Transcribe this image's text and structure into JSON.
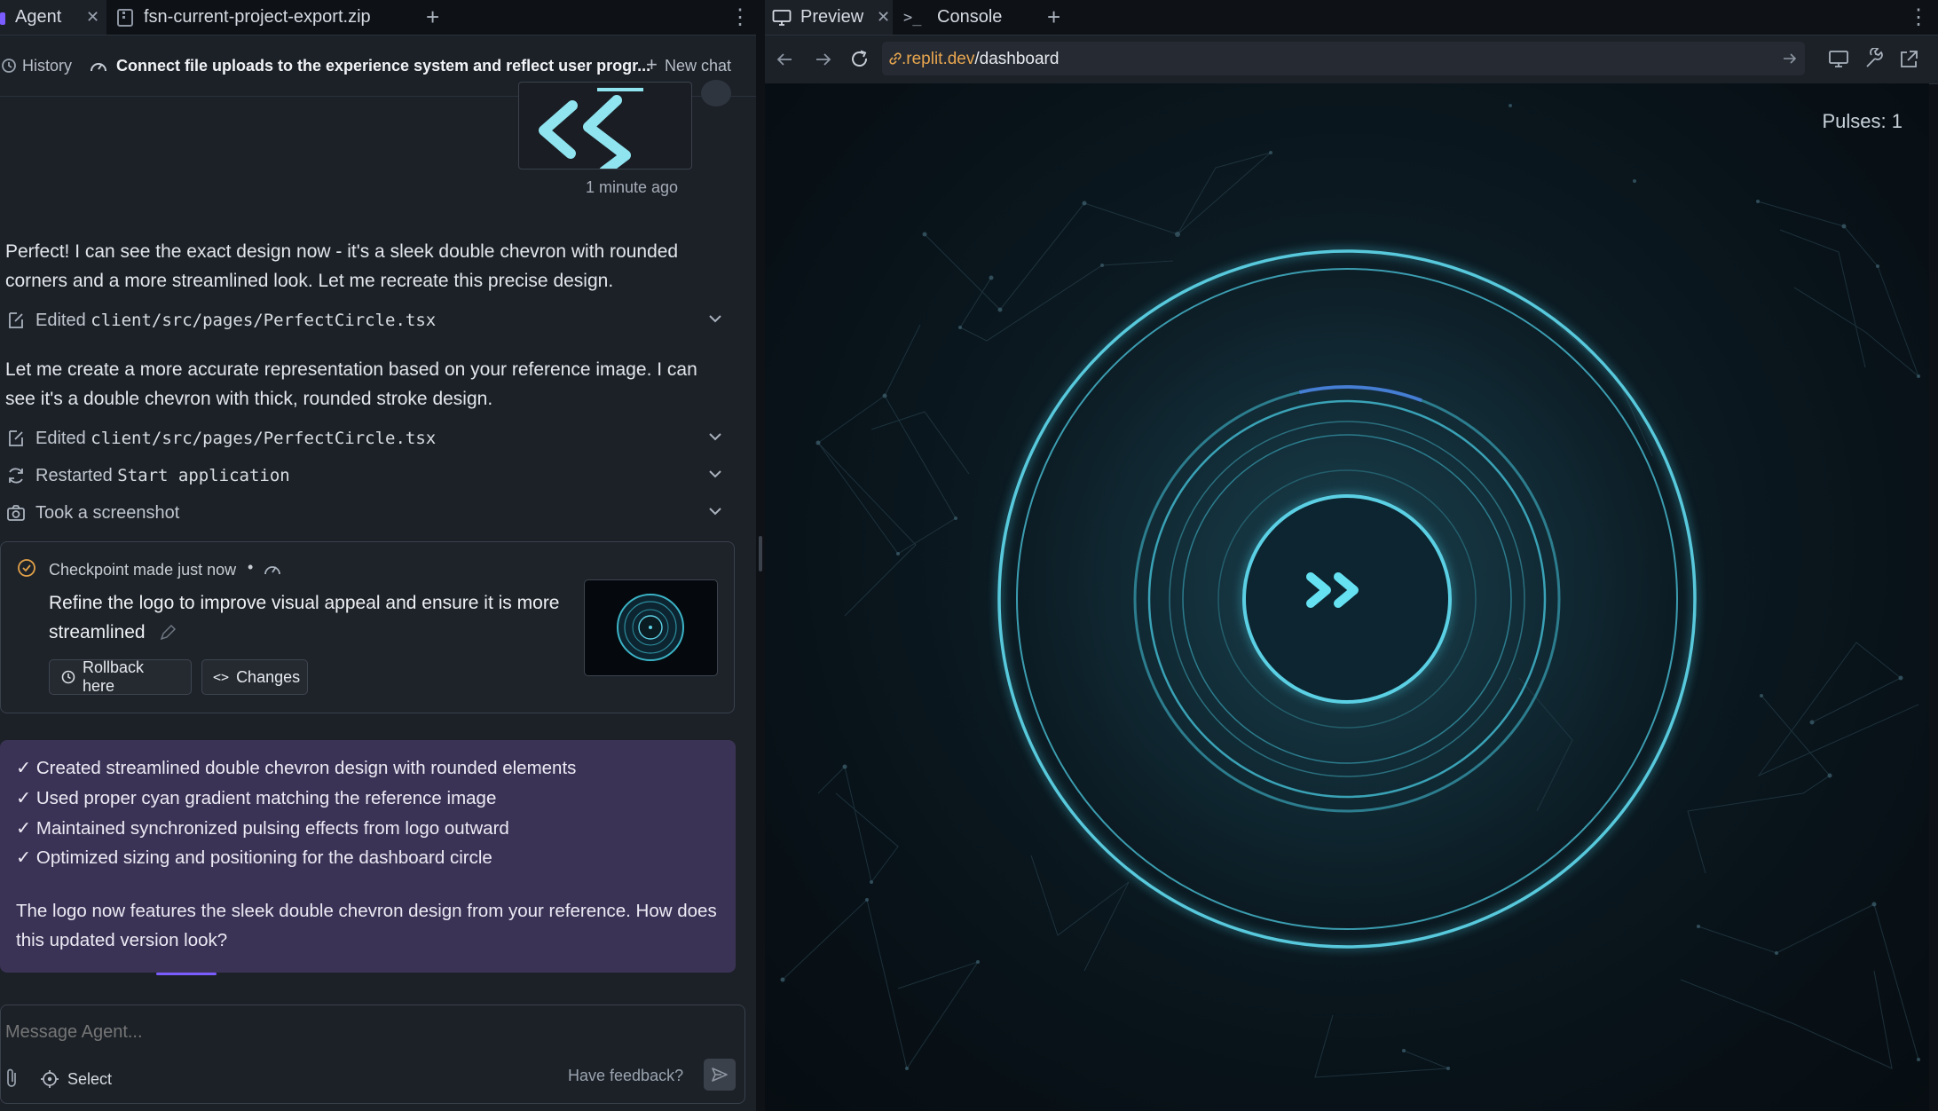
{
  "left_tabs": {
    "agent": "Agent",
    "file": "fsn-current-project-export.zip"
  },
  "subheader": {
    "history": "History",
    "title": "Connect file uploads to the experience system and reflect user progr...",
    "new_chat": "New chat"
  },
  "chat": {
    "timestamp": "1 minute ago",
    "msg1": "Perfect! I can see the exact design now - it's a sleek double chevron with rounded corners and a more streamlined look. Let me recreate this precise design.",
    "action1_verb": "Edited",
    "action1_target": "client/src/pages/PerfectCircle.tsx",
    "msg2": "Let me create a more accurate representation based on your reference image. I can see it's a double chevron with thick, rounded stroke design.",
    "action2_verb": "Edited",
    "action2_target": "client/src/pages/PerfectCircle.tsx",
    "action3_verb": "Restarted",
    "action3_target": "Start application",
    "action4": "Took a screenshot"
  },
  "checkpoint": {
    "status": "Checkpoint made just now",
    "description": "Refine the logo to improve visual appeal and ensure it is more streamlined",
    "rollback": "Rollback here",
    "changes": "Changes"
  },
  "summary": {
    "lines": [
      "✓ Created streamlined double chevron design with rounded elements",
      "✓ Used proper cyan gradient matching the reference image",
      "✓ Maintained synchronized pulsing effects from logo outward",
      "✓ Optimized sizing and positioning for the dashboard circle"
    ],
    "closing": "The logo now features the sleek double chevron design from your reference. How does this updated version look?"
  },
  "composer": {
    "placeholder": "Message Agent...",
    "select": "Select",
    "feedback": "Have feedback?"
  },
  "right_tabs": {
    "preview": "Preview",
    "console": "Console"
  },
  "url": {
    "host": ".replit.dev",
    "path": "/dashboard"
  },
  "preview": {
    "pulses": "Pulses: 1"
  },
  "colors": {
    "accent_cyan": "#5fd3e6",
    "agent_purple": "#7b5cff",
    "summary_bg": "#3b3356",
    "url_host": "#e8a64f"
  }
}
